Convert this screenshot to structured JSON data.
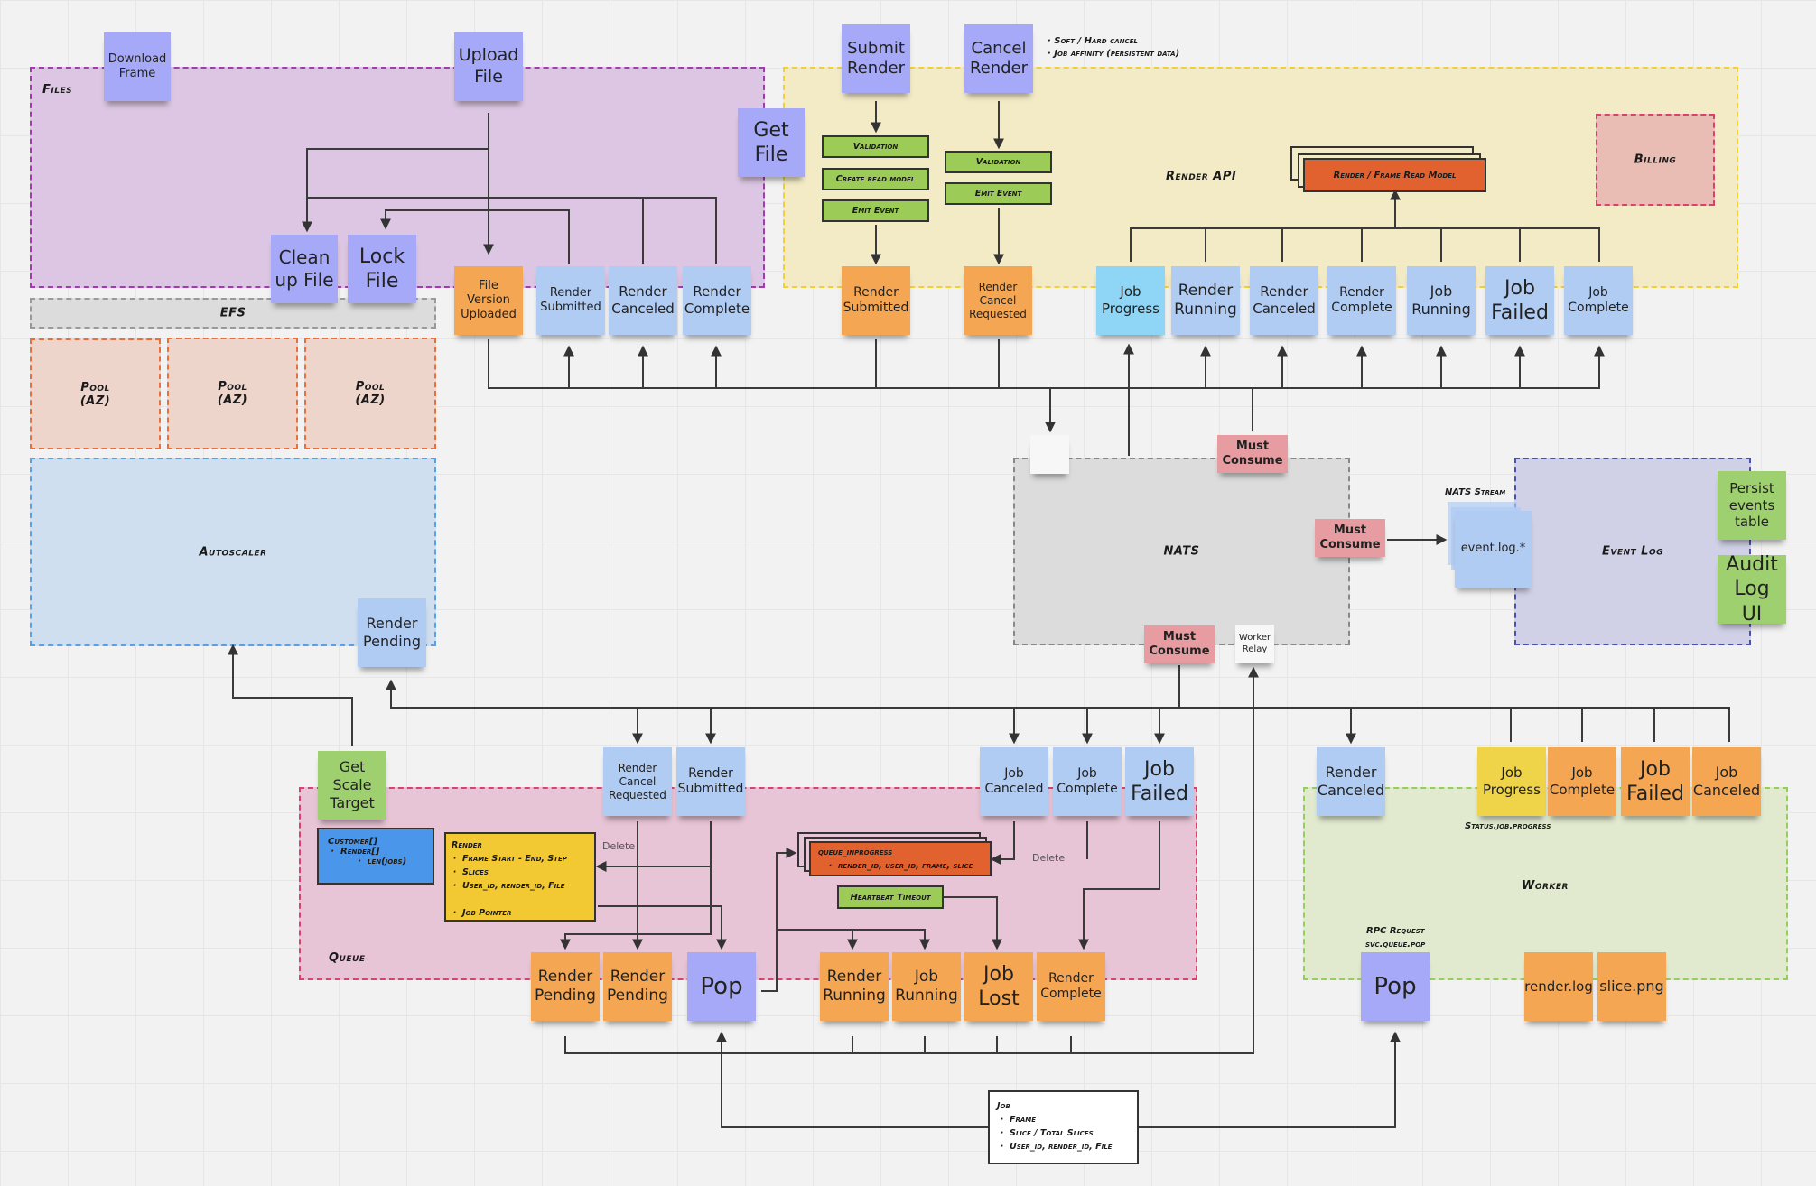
{
  "zones": {
    "files": "Files",
    "efs": "EFS",
    "pools": [
      "Pool\n(AZ)",
      "Pool\n(AZ)",
      "Pool\n(AZ)"
    ],
    "autoscaler": "Autoscaler",
    "render_api": "Render API",
    "billing": "Billing",
    "nats": "NATS",
    "event_log": "Event Log",
    "queue": "Queue",
    "worker": "Worker"
  },
  "colors": {
    "files_zone": "#dcc6e3",
    "render_api_zone": "#f3ebc6",
    "nats_zone": "#dcdcdc",
    "event_log_zone": "#d0d0e6",
    "queue_zone": "#e7c4d6",
    "worker_zone": "#e1eacf",
    "autoscaler_zone": "#cfdff0",
    "pool_zone": "#eed5cc",
    "billing_zone": "#e9bdb4",
    "read_model": "#e2622f",
    "process_step": "#9ccb57",
    "customer_box": "#4a96ea",
    "render_box": "#f2c833"
  },
  "stickies": {
    "download_frame": "Download\nFrame",
    "upload_file": "Upload\nFile",
    "get_file": "Get\nFile",
    "clean_up_file": "Clean\nup File",
    "lock_file": "Lock\nFile",
    "file_version_uploaded": "File\nVersion\nUploaded",
    "files_render_submitted": "Render\nSubmitted",
    "files_render_canceled": "Render\nCanceled",
    "files_render_complete": "Render\nComplete",
    "submit_render": "Submit\nRender",
    "cancel_render": "Cancel\nRender",
    "api_render_submitted": "Render\nSubmitted",
    "api_render_cancel_requested": "Render\nCancel\nRequested",
    "api_job_progress": "Job\nProgress",
    "api_render_running": "Render\nRunning",
    "api_render_canceled": "Render\nCanceled",
    "api_render_complete": "Render\nComplete",
    "api_job_running": "Job\nRunning",
    "api_job_failed": "Job\nFailed",
    "api_job_complete": "Job\nComplete",
    "must_consume_top": "Must\nConsume",
    "must_consume_right": "Must\nConsume",
    "must_consume_bottom": "Must\nConsume",
    "worker_relay": "Worker\nRelay",
    "nats_blank": "",
    "event_log_stream": "event.log.*",
    "persist_events_table": "Persist\nevents\ntable",
    "audit_log_ui": "Audit\nLog UI",
    "autoscaler_render_pending": "Render\nPending",
    "get_scale_target": "Get\nScale\nTarget",
    "queue_render_cancel_requested": "Render\nCancel\nRequested",
    "queue_render_submitted": "Render\nSubmitted",
    "queue_job_canceled": "Job\nCanceled",
    "queue_job_complete": "Job\nComplete",
    "queue_job_failed": "Job\nFailed",
    "queue_render_pending_1": "Render\nPending",
    "queue_render_pending_2": "Render\nPending",
    "queue_pop": "Pop",
    "queue_render_running": "Render\nRunning",
    "queue_job_running": "Job\nRunning",
    "queue_job_lost": "Job\nLost",
    "queue_render_complete": "Render\nComplete",
    "worker_render_canceled": "Render\nCanceled",
    "worker_job_progress": "Job\nProgress",
    "worker_job_complete": "Job\nComplete",
    "worker_job_failed": "Job\nFailed",
    "worker_job_canceled": "Job\nCanceled",
    "worker_pop": "Pop",
    "render_log": "render.log",
    "slice_png": "slice.png"
  },
  "steps": {
    "submit": [
      "Validation",
      "Create read model",
      "Emit Event"
    ],
    "cancel": [
      "Validation",
      "Emit Event"
    ],
    "heartbeat_timeout": "Heartbeat Timeout"
  },
  "read_model": "Render / Frame Read Model",
  "cancel_notes": [
    "Soft / Hard cancel",
    "Job affinity (persistent data)"
  ],
  "nats_stream_label": "NATS Stream",
  "worker_notes": {
    "status_progress": "Status.job.progress",
    "rpc_request": "RPC Request",
    "rpc_subject": "svc.queue.pop"
  },
  "customer_box": {
    "title": "Customer[]",
    "items": [
      "Render[]"
    ],
    "sub_items": [
      "len(jobs)"
    ]
  },
  "render_box": {
    "title": "Render",
    "items": [
      "Frame Start - End, Step",
      "Slices",
      "User_id, render_id, File",
      "Job Pointer"
    ]
  },
  "queue_inprogress_box": {
    "title": "queue_inprogress",
    "items": [
      "render_id, user_id, frame, slice"
    ]
  },
  "job_box": {
    "title": "Job",
    "items": [
      "Frame",
      "Slice / Total Slices",
      "User_id, render_id, File"
    ]
  },
  "edge_labels": {
    "delete_render": "Delete",
    "delete_inprogress": "Delete"
  }
}
